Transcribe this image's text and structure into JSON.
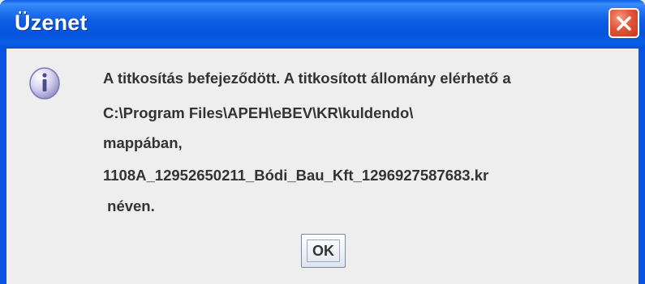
{
  "window": {
    "title": "Üzenet",
    "close_icon": "close-icon"
  },
  "message": {
    "icon": "info-icon",
    "lines": [
      "A titkosítás befejeződött. A titkosított állomány elérhető a",
      "C:\\Program Files\\APEH\\eBEV\\KR\\kuldendo\\",
      "mappában,",
      "1108A_12952650211_Bódi_Bau_Kft_1296927587683.kr",
      " néven."
    ]
  },
  "buttons": {
    "ok_label": "OK"
  },
  "colors": {
    "titlebar": "#0a5fe8",
    "close_button": "#e2553a",
    "client_background": "#eeeeee",
    "text": "#333333"
  }
}
